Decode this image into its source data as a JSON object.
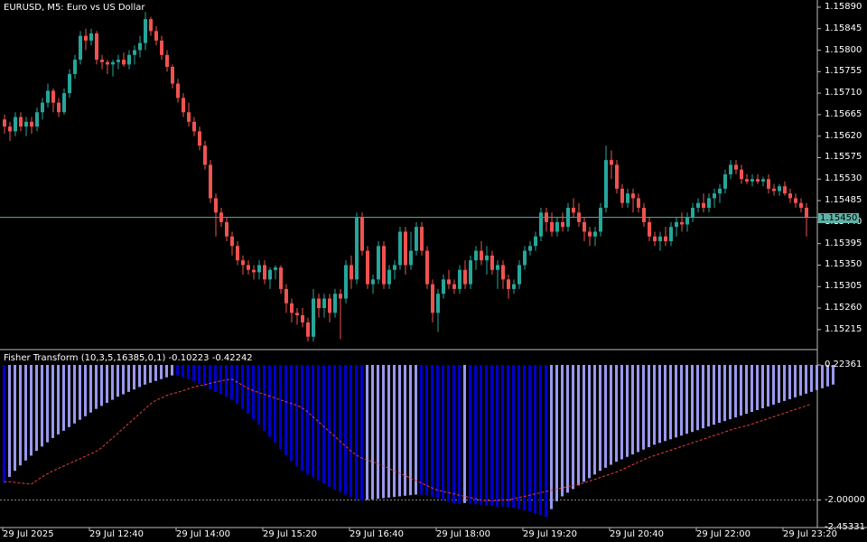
{
  "main_chart": {
    "symbol_caption": "EURUSD, M5:  Euro vs US Dollar",
    "current_price": "1.15450",
    "y_labels": [
      "1.15890",
      "1.15845",
      "1.15800",
      "1.15755",
      "1.15710",
      "1.15665",
      "1.15620",
      "1.15575",
      "1.15530",
      "1.15485",
      "1.15440",
      "1.15395",
      "1.15350",
      "1.15305",
      "1.15260",
      "1.15215"
    ],
    "colors": {
      "bull": "#26a69a",
      "bear": "#ef5350",
      "bid_line": "#5fb3a6"
    },
    "chart_data": {
      "type": "candlestick",
      "ylim": [
        1.15175,
        1.15905
      ],
      "candles": [
        [
          1.15655,
          1.15665,
          1.15625,
          1.1564
        ],
        [
          1.1564,
          1.1565,
          1.1561,
          1.1563
        ],
        [
          1.1563,
          1.1567,
          1.1562,
          1.1566
        ],
        [
          1.1566,
          1.1567,
          1.1563,
          1.1564
        ],
        [
          1.1564,
          1.1566,
          1.1562,
          1.1565
        ],
        [
          1.1565,
          1.1566,
          1.15625,
          1.1564
        ],
        [
          1.1564,
          1.1568,
          1.1563,
          1.1567
        ],
        [
          1.1567,
          1.157,
          1.15655,
          1.1569
        ],
        [
          1.1569,
          1.1573,
          1.1568,
          1.15715
        ],
        [
          1.15715,
          1.1572,
          1.1567,
          1.1569
        ],
        [
          1.1569,
          1.157,
          1.1566,
          1.1567
        ],
        [
          1.1567,
          1.1572,
          1.15665,
          1.1571
        ],
        [
          1.1571,
          1.1576,
          1.157,
          1.1575
        ],
        [
          1.1575,
          1.1579,
          1.1574,
          1.1578
        ],
        [
          1.1578,
          1.1584,
          1.1577,
          1.1583
        ],
        [
          1.1583,
          1.15845,
          1.158,
          1.1582
        ],
        [
          1.1582,
          1.15845,
          1.1581,
          1.15835
        ],
        [
          1.15835,
          1.1584,
          1.1577,
          1.1578
        ],
        [
          1.1578,
          1.1579,
          1.1576,
          1.15775
        ],
        [
          1.15775,
          1.1578,
          1.1575,
          1.1577
        ],
        [
          1.1577,
          1.1578,
          1.15745,
          1.15775
        ],
        [
          1.15775,
          1.1579,
          1.1576,
          1.1578
        ],
        [
          1.1578,
          1.15795,
          1.15765,
          1.1577
        ],
        [
          1.1577,
          1.158,
          1.1576,
          1.1579
        ],
        [
          1.1579,
          1.1581,
          1.1577,
          1.158
        ],
        [
          1.158,
          1.1583,
          1.15785,
          1.15815
        ],
        [
          1.15815,
          1.1588,
          1.158,
          1.15865
        ],
        [
          1.15865,
          1.1587,
          1.1583,
          1.1584
        ],
        [
          1.1584,
          1.1585,
          1.1581,
          1.1582
        ],
        [
          1.1582,
          1.1583,
          1.1578,
          1.1579
        ],
        [
          1.1579,
          1.158,
          1.15755,
          1.15765
        ],
        [
          1.15765,
          1.1577,
          1.1572,
          1.1573
        ],
        [
          1.1573,
          1.1574,
          1.1569,
          1.157
        ],
        [
          1.157,
          1.1571,
          1.1566,
          1.1567
        ],
        [
          1.1567,
          1.1569,
          1.1564,
          1.1565
        ],
        [
          1.1565,
          1.1566,
          1.1562,
          1.1563
        ],
        [
          1.1563,
          1.1564,
          1.1559,
          1.156
        ],
        [
          1.156,
          1.1561,
          1.1555,
          1.1556
        ],
        [
          1.1556,
          1.1557,
          1.1548,
          1.1549
        ],
        [
          1.1549,
          1.155,
          1.1541,
          1.1546
        ],
        [
          1.1546,
          1.1547,
          1.1543,
          1.1544
        ],
        [
          1.1544,
          1.1545,
          1.154,
          1.1541
        ],
        [
          1.1541,
          1.1542,
          1.1537,
          1.1539
        ],
        [
          1.1539,
          1.154,
          1.1535,
          1.1536
        ],
        [
          1.1536,
          1.1537,
          1.1533,
          1.1535
        ],
        [
          1.1535,
          1.1536,
          1.1533,
          1.1534
        ],
        [
          1.1534,
          1.1535,
          1.1532,
          1.15335
        ],
        [
          1.15335,
          1.1536,
          1.1532,
          1.1535
        ],
        [
          1.1535,
          1.1536,
          1.1531,
          1.1532
        ],
        [
          1.1532,
          1.15345,
          1.153,
          1.1534
        ],
        [
          1.1534,
          1.1535,
          1.1532,
          1.15345
        ],
        [
          1.15345,
          1.1535,
          1.1529,
          1.153
        ],
        [
          1.153,
          1.1531,
          1.1525,
          1.1527
        ],
        [
          1.1527,
          1.1528,
          1.1523,
          1.1525
        ],
        [
          1.1525,
          1.1526,
          1.15225,
          1.15245
        ],
        [
          1.15245,
          1.1526,
          1.1522,
          1.1523
        ],
        [
          1.1523,
          1.1524,
          1.1519,
          1.152
        ],
        [
          1.152,
          1.153,
          1.1519,
          1.1528
        ],
        [
          1.1528,
          1.1529,
          1.1524,
          1.1526
        ],
        [
          1.1526,
          1.1529,
          1.1524,
          1.1528
        ],
        [
          1.1528,
          1.1529,
          1.1523,
          1.1525
        ],
        [
          1.1525,
          1.153,
          1.1524,
          1.1529
        ],
        [
          1.1529,
          1.153,
          1.15195,
          1.1528
        ],
        [
          1.1528,
          1.1536,
          1.1527,
          1.1535
        ],
        [
          1.1535,
          1.1537,
          1.153,
          1.1532
        ],
        [
          1.1532,
          1.1546,
          1.1531,
          1.1545
        ],
        [
          1.1545,
          1.1546,
          1.1537,
          1.1538
        ],
        [
          1.1538,
          1.1539,
          1.153,
          1.1531
        ],
        [
          1.1531,
          1.1533,
          1.1529,
          1.1532
        ],
        [
          1.1532,
          1.154,
          1.1531,
          1.1539
        ],
        [
          1.1539,
          1.154,
          1.153,
          1.1531
        ],
        [
          1.1531,
          1.1535,
          1.153,
          1.1534
        ],
        [
          1.1534,
          1.1536,
          1.1532,
          1.1535
        ],
        [
          1.1535,
          1.1543,
          1.1534,
          1.1542
        ],
        [
          1.1542,
          1.1543,
          1.1533,
          1.1535
        ],
        [
          1.1535,
          1.1542,
          1.1534,
          1.1538
        ],
        [
          1.1538,
          1.1544,
          1.1537,
          1.1543
        ],
        [
          1.1543,
          1.1544,
          1.1537,
          1.1538
        ],
        [
          1.1538,
          1.1539,
          1.153,
          1.1531
        ],
        [
          1.1531,
          1.1532,
          1.1523,
          1.1525
        ],
        [
          1.1525,
          1.153,
          1.1521,
          1.1529
        ],
        [
          1.1529,
          1.1533,
          1.1528,
          1.1532
        ],
        [
          1.1532,
          1.1534,
          1.153,
          1.1531
        ],
        [
          1.1531,
          1.1532,
          1.1529,
          1.153
        ],
        [
          1.153,
          1.1535,
          1.1529,
          1.1534
        ],
        [
          1.1534,
          1.1536,
          1.153,
          1.1531
        ],
        [
          1.1531,
          1.1537,
          1.153,
          1.1536
        ],
        [
          1.1536,
          1.1539,
          1.1534,
          1.1538
        ],
        [
          1.1538,
          1.154,
          1.1535,
          1.1536
        ],
        [
          1.1536,
          1.1539,
          1.1533,
          1.1537
        ],
        [
          1.1537,
          1.1538,
          1.1533,
          1.1534
        ],
        [
          1.1534,
          1.1536,
          1.153,
          1.1535
        ],
        [
          1.1535,
          1.1536,
          1.153,
          1.1532
        ],
        [
          1.1532,
          1.1533,
          1.1528,
          1.153
        ],
        [
          1.153,
          1.1532,
          1.1529,
          1.1531
        ],
        [
          1.1531,
          1.1536,
          1.153,
          1.1535
        ],
        [
          1.1535,
          1.1539,
          1.1534,
          1.1538
        ],
        [
          1.1538,
          1.154,
          1.1537,
          1.1539
        ],
        [
          1.1539,
          1.1542,
          1.1538,
          1.1541
        ],
        [
          1.1541,
          1.1547,
          1.154,
          1.1546
        ],
        [
          1.1546,
          1.1547,
          1.1542,
          1.1544
        ],
        [
          1.1544,
          1.1546,
          1.1541,
          1.1542
        ],
        [
          1.1542,
          1.1545,
          1.1541,
          1.1544
        ],
        [
          1.1544,
          1.1546,
          1.1542,
          1.1543
        ],
        [
          1.1543,
          1.1548,
          1.1542,
          1.1547
        ],
        [
          1.1547,
          1.1549,
          1.1545,
          1.1546
        ],
        [
          1.1546,
          1.1548,
          1.1543,
          1.1544
        ],
        [
          1.1544,
          1.1545,
          1.154,
          1.1542
        ],
        [
          1.1542,
          1.1543,
          1.1539,
          1.1541
        ],
        [
          1.1541,
          1.1543,
          1.1539,
          1.1542
        ],
        [
          1.1542,
          1.1548,
          1.1541,
          1.1547
        ],
        [
          1.1547,
          1.156,
          1.1546,
          1.1557
        ],
        [
          1.1557,
          1.1559,
          1.1553,
          1.1556
        ],
        [
          1.1556,
          1.1557,
          1.155,
          1.1551
        ],
        [
          1.1551,
          1.1552,
          1.1547,
          1.1548
        ],
        [
          1.1548,
          1.1551,
          1.1547,
          1.155
        ],
        [
          1.155,
          1.1551,
          1.1546,
          1.1549
        ],
        [
          1.1549,
          1.155,
          1.1546,
          1.1547
        ],
        [
          1.1547,
          1.1548,
          1.1543,
          1.1544
        ],
        [
          1.1544,
          1.1545,
          1.154,
          1.1541
        ],
        [
          1.1541,
          1.1542,
          1.1539,
          1.154
        ],
        [
          1.154,
          1.1542,
          1.1538,
          1.1541
        ],
        [
          1.1541,
          1.1543,
          1.1539,
          1.154
        ],
        [
          1.154,
          1.1544,
          1.1539,
          1.1543
        ],
        [
          1.1543,
          1.1545,
          1.1541,
          1.1544
        ],
        [
          1.1544,
          1.1546,
          1.1542,
          1.15435
        ],
        [
          1.15435,
          1.1546,
          1.1542,
          1.1545
        ],
        [
          1.1545,
          1.1548,
          1.1544,
          1.1547
        ],
        [
          1.1547,
          1.1549,
          1.1546,
          1.1548
        ],
        [
          1.1548,
          1.155,
          1.1546,
          1.1547
        ],
        [
          1.1547,
          1.155,
          1.1546,
          1.1549
        ],
        [
          1.1549,
          1.1551,
          1.1547,
          1.155
        ],
        [
          1.155,
          1.1552,
          1.1548,
          1.1551
        ],
        [
          1.1551,
          1.1555,
          1.155,
          1.1554
        ],
        [
          1.1554,
          1.1557,
          1.1553,
          1.1556
        ],
        [
          1.1556,
          1.1557,
          1.1554,
          1.1555
        ],
        [
          1.1555,
          1.1556,
          1.1552,
          1.1553
        ],
        [
          1.1553,
          1.1554,
          1.1552,
          1.15525
        ],
        [
          1.15525,
          1.1554,
          1.15515,
          1.1553
        ],
        [
          1.1553,
          1.1554,
          1.1552,
          1.15525
        ],
        [
          1.15525,
          1.15535,
          1.15515,
          1.1553
        ],
        [
          1.1553,
          1.1554,
          1.155,
          1.1551
        ],
        [
          1.1551,
          1.1552,
          1.15495,
          1.15505
        ],
        [
          1.15505,
          1.1552,
          1.15495,
          1.15515
        ],
        [
          1.15515,
          1.15525,
          1.15495,
          1.155
        ],
        [
          1.155,
          1.1551,
          1.1548,
          1.1549
        ],
        [
          1.1549,
          1.155,
          1.1547,
          1.1548
        ],
        [
          1.1548,
          1.1549,
          1.1546,
          1.1547
        ],
        [
          1.1547,
          1.1548,
          1.1541,
          1.1545
        ]
      ]
    }
  },
  "indicator": {
    "caption": "Fisher Transform (10,3,5,16385,0,1) -0.10223 -0.42242",
    "y_labels": [
      "0.22361",
      "-2.00000",
      "-2.45331"
    ],
    "colors": {
      "bar_light": "#9999ee",
      "bar_dark": "#0000cc",
      "signal": "#e84040",
      "level": "#888888"
    },
    "chart_data": {
      "type": "bar",
      "ylim": [
        -2.45331,
        0.22361
      ],
      "level": -2.0,
      "fisher": [
        -1.72,
        -1.62,
        -1.52,
        -1.43,
        -1.35,
        -1.27,
        -1.19,
        -1.12,
        -1.05,
        -0.98,
        -0.92,
        -0.86,
        -0.8,
        -0.74,
        -0.68,
        -0.62,
        -0.56,
        -0.5,
        -0.45,
        -0.4,
        -0.35,
        -0.3,
        -0.26,
        -0.22,
        -0.18,
        -0.14,
        -0.1,
        -0.07,
        -0.04,
        -0.01,
        0.02,
        0.05,
        0.05,
        0.02,
        -0.01,
        -0.05,
        -0.09,
        -0.13,
        -0.18,
        -0.22,
        -0.26,
        -0.3,
        -0.35,
        -0.42,
        -0.5,
        -0.58,
        -0.67,
        -0.76,
        -0.86,
        -0.96,
        -1.06,
        -1.16,
        -1.26,
        -1.36,
        -1.45,
        -1.52,
        -1.58,
        -1.63,
        -1.68,
        -1.73,
        -1.78,
        -1.83,
        -1.87,
        -1.91,
        -1.95,
        -1.99,
        -2.01,
        -2.0,
        -1.99,
        -1.98,
        -1.97,
        -1.96,
        -1.95,
        -1.94,
        -1.93,
        -1.92,
        -1.91,
        -1.91,
        -1.92,
        -1.95,
        -1.97,
        -2.0,
        -2.03,
        -2.05,
        -2.06,
        -2.05,
        -2.06,
        -2.07,
        -2.08,
        -2.09,
        -2.1,
        -2.11,
        -2.11,
        -2.12,
        -2.13,
        -2.15,
        -2.17,
        -2.19,
        -2.22,
        -2.25,
        -2.28,
        -2.15,
        -2.02,
        -1.94,
        -1.88,
        -1.82,
        -1.76,
        -1.7,
        -1.64,
        -1.58,
        -1.52,
        -1.47,
        -1.42,
        -1.37,
        -1.33,
        -1.29,
        -1.25,
        -1.21,
        -1.17,
        -1.13,
        -1.09,
        -1.06,
        -1.03,
        -1.0,
        -0.97,
        -0.94,
        -0.91,
        -0.88,
        -0.85,
        -0.82,
        -0.79,
        -0.76,
        -0.73,
        -0.7,
        -0.67,
        -0.64,
        -0.61,
        -0.58,
        -0.55,
        -0.52,
        -0.49,
        -0.46,
        -0.43,
        -0.4,
        -0.37,
        -0.34,
        -0.31,
        -0.28,
        -0.25,
        -0.22,
        -0.19,
        -0.16,
        -0.13,
        -0.1
      ],
      "signal": [
        -1.7,
        -1.7,
        -1.71,
        -1.72,
        -1.73,
        -1.74,
        -1.68,
        -1.62,
        -1.57,
        -1.52,
        -1.48,
        -1.44,
        -1.4,
        -1.36,
        -1.32,
        -1.28,
        -1.24,
        -1.2,
        -1.14,
        -1.06,
        -0.98,
        -0.9,
        -0.82,
        -0.74,
        -0.66,
        -0.58,
        -0.5,
        -0.42,
        -0.36,
        -0.32,
        -0.28,
        -0.25,
        -0.23,
        -0.2,
        -0.17,
        -0.14,
        -0.12,
        -0.1,
        -0.08,
        -0.06,
        -0.04,
        -0.02,
        -0.01,
        -0.06,
        -0.11,
        -0.16,
        -0.2,
        -0.23,
        -0.26,
        -0.29,
        -0.32,
        -0.35,
        -0.38,
        -0.41,
        -0.44,
        -0.48,
        -0.55,
        -0.63,
        -0.71,
        -0.79,
        -0.87,
        -0.95,
        -1.03,
        -1.11,
        -1.19,
        -1.26,
        -1.31,
        -1.34,
        -1.37,
        -1.4,
        -1.44,
        -1.48,
        -1.52,
        -1.56,
        -1.6,
        -1.64,
        -1.68,
        -1.72,
        -1.76,
        -1.8,
        -1.84,
        -1.86,
        -1.88,
        -1.9,
        -1.92,
        -1.94,
        -1.96,
        -1.98,
        -2.0,
        -2.01,
        -2.01,
        -2.01,
        -2.0,
        -2.0,
        -1.98,
        -1.96,
        -1.94,
        -1.92,
        -1.9,
        -1.88,
        -1.86,
        -1.84,
        -1.82,
        -1.8,
        -1.78,
        -1.76,
        -1.74,
        -1.72,
        -1.69,
        -1.66,
        -1.63,
        -1.6,
        -1.57,
        -1.54,
        -1.5,
        -1.46,
        -1.42,
        -1.38,
        -1.34,
        -1.3,
        -1.27,
        -1.24,
        -1.21,
        -1.18,
        -1.15,
        -1.12,
        -1.09,
        -1.06,
        -1.03,
        -1.0,
        -0.97,
        -0.94,
        -0.91,
        -0.88,
        -0.85,
        -0.82,
        -0.8,
        -0.78,
        -0.75,
        -0.72,
        -0.69,
        -0.66,
        -0.63,
        -0.6,
        -0.57,
        -0.54,
        -0.51,
        -0.48,
        -0.45,
        -0.42
      ]
    }
  },
  "time_axis": {
    "labels": [
      "29 Jul 2025",
      "29 Jul 12:40",
      "29 Jul 14:00",
      "29 Jul 15:20",
      "29 Jul 16:40",
      "29 Jul 18:00",
      "29 Jul 19:20",
      "29 Jul 20:40",
      "29 Jul 22:00",
      "29 Jul 23:20"
    ]
  }
}
